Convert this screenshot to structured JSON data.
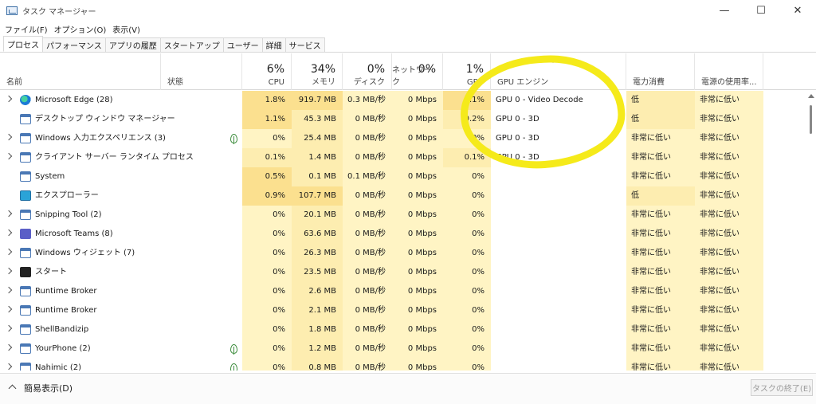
{
  "window": {
    "title": "タスク マネージャー",
    "minimize_icon": "minimize-icon",
    "maximize_icon": "maximize-icon",
    "close_icon": "close-icon"
  },
  "menu": [
    "ファイル(F)",
    "オプション(O)",
    "表示(V)"
  ],
  "tabs": [
    "プロセス",
    "パフォーマンス",
    "アプリの履歴",
    "スタートアップ",
    "ユーザー",
    "詳細",
    "サービス"
  ],
  "active_tab": "プロセス",
  "columns": {
    "name": "名前",
    "status": "状態",
    "cpu": {
      "pct": "6%",
      "label": "CPU"
    },
    "memory": {
      "pct": "34%",
      "label": "メモリ"
    },
    "disk": {
      "pct": "0%",
      "label": "ディスク"
    },
    "network": {
      "pct": "0%",
      "label": "ネットワーク"
    },
    "gpu": {
      "pct": "1%",
      "label": "GPU"
    },
    "gpu_engine": "GPU エンジン",
    "power": "電力消費",
    "power_trend": "電源の使用率..."
  },
  "colors": {
    "heat_light": "#fff4c4",
    "heat_medium": "#fdedb0",
    "heat_strong": "#fbe08f",
    "annotation": "#f5ea1a"
  },
  "processes": [
    {
      "name": "Microsoft Edge (28)",
      "icon": "edge-icon",
      "expandable": true,
      "leaf": false,
      "cpu": "1.8%",
      "memory": "919.7 MB",
      "disk": "0.3 MB/秒",
      "network": "0 Mbps",
      "gpu": "1.1%",
      "gpu_engine": "GPU 0 - Video Decode",
      "power": "低",
      "power_trend": "非常に低い"
    },
    {
      "name": "デスクトップ ウィンドウ マネージャー",
      "icon": "window-icon",
      "expandable": false,
      "leaf": false,
      "cpu": "1.1%",
      "memory": "45.3 MB",
      "disk": "0 MB/秒",
      "network": "0 Mbps",
      "gpu": "0.2%",
      "gpu_engine": "GPU 0 - 3D",
      "power": "低",
      "power_trend": "非常に低い"
    },
    {
      "name": "Windows 入力エクスペリエンス (3)",
      "icon": "window-icon",
      "expandable": true,
      "leaf": true,
      "cpu": "0%",
      "memory": "25.4 MB",
      "disk": "0 MB/秒",
      "network": "0 Mbps",
      "gpu": "0%",
      "gpu_engine": "GPU 0 - 3D",
      "power": "非常に低い",
      "power_trend": "非常に低い"
    },
    {
      "name": "クライアント サーバー ランタイム プロセス",
      "icon": "window-icon",
      "expandable": true,
      "leaf": false,
      "cpu": "0.1%",
      "memory": "1.4 MB",
      "disk": "0 MB/秒",
      "network": "0 Mbps",
      "gpu": "0.1%",
      "gpu_engine": "GPU 0 - 3D",
      "power": "非常に低い",
      "power_trend": "非常に低い"
    },
    {
      "name": "System",
      "icon": "window-icon",
      "expandable": false,
      "leaf": false,
      "cpu": "0.5%",
      "memory": "0.1 MB",
      "disk": "0.1 MB/秒",
      "network": "0 Mbps",
      "gpu": "0%",
      "gpu_engine": "",
      "power": "非常に低い",
      "power_trend": "非常に低い"
    },
    {
      "name": "エクスプローラー",
      "icon": "monitor-icon",
      "expandable": false,
      "leaf": false,
      "cpu": "0.9%",
      "memory": "107.7 MB",
      "disk": "0 MB/秒",
      "network": "0 Mbps",
      "gpu": "0%",
      "gpu_engine": "",
      "power": "低",
      "power_trend": "非常に低い"
    },
    {
      "name": "Snipping Tool (2)",
      "icon": "snipping-icon",
      "expandable": true,
      "leaf": false,
      "cpu": "0%",
      "memory": "20.1 MB",
      "disk": "0 MB/秒",
      "network": "0 Mbps",
      "gpu": "0%",
      "gpu_engine": "",
      "power": "非常に低い",
      "power_trend": "非常に低い"
    },
    {
      "name": "Microsoft Teams (8)",
      "icon": "teams-icon",
      "expandable": true,
      "leaf": false,
      "cpu": "0%",
      "memory": "63.6 MB",
      "disk": "0 MB/秒",
      "network": "0 Mbps",
      "gpu": "0%",
      "gpu_engine": "",
      "power": "非常に低い",
      "power_trend": "非常に低い"
    },
    {
      "name": "Windows ウィジェット (7)",
      "icon": "widgets-icon",
      "expandable": true,
      "leaf": false,
      "cpu": "0%",
      "memory": "26.3 MB",
      "disk": "0 MB/秒",
      "network": "0 Mbps",
      "gpu": "0%",
      "gpu_engine": "",
      "power": "非常に低い",
      "power_trend": "非常に低い"
    },
    {
      "name": "スタート",
      "icon": "start-icon",
      "expandable": true,
      "leaf": false,
      "cpu": "0%",
      "memory": "23.5 MB",
      "disk": "0 MB/秒",
      "network": "0 Mbps",
      "gpu": "0%",
      "gpu_engine": "",
      "power": "非常に低い",
      "power_trend": "非常に低い"
    },
    {
      "name": "Runtime Broker",
      "icon": "window-icon",
      "expandable": true,
      "leaf": false,
      "cpu": "0%",
      "memory": "2.6 MB",
      "disk": "0 MB/秒",
      "network": "0 Mbps",
      "gpu": "0%",
      "gpu_engine": "",
      "power": "非常に低い",
      "power_trend": "非常に低い"
    },
    {
      "name": "Runtime Broker",
      "icon": "window-icon",
      "expandable": true,
      "leaf": false,
      "cpu": "0%",
      "memory": "2.1 MB",
      "disk": "0 MB/秒",
      "network": "0 Mbps",
      "gpu": "0%",
      "gpu_engine": "",
      "power": "非常に低い",
      "power_trend": "非常に低い"
    },
    {
      "name": "ShellBandizip",
      "icon": "window-icon",
      "expandable": true,
      "leaf": false,
      "cpu": "0%",
      "memory": "1.8 MB",
      "disk": "0 MB/秒",
      "network": "0 Mbps",
      "gpu": "0%",
      "gpu_engine": "",
      "power": "非常に低い",
      "power_trend": "非常に低い"
    },
    {
      "name": "YourPhone (2)",
      "icon": "window-icon",
      "expandable": true,
      "leaf": true,
      "cpu": "0%",
      "memory": "1.2 MB",
      "disk": "0 MB/秒",
      "network": "0 Mbps",
      "gpu": "0%",
      "gpu_engine": "",
      "power": "非常に低い",
      "power_trend": "非常に低い"
    },
    {
      "name": "Nahimic (2)",
      "icon": "window-icon",
      "expandable": true,
      "leaf": true,
      "cpu": "0%",
      "memory": "0.8 MB",
      "disk": "0 MB/秒",
      "network": "0 Mbps",
      "gpu": "0%",
      "gpu_engine": "",
      "power": "非常に低い",
      "power_trend": "非常に低い"
    }
  ],
  "footer": {
    "fewer_details": "簡易表示(D)",
    "end_task": "タスクの終了(E)"
  }
}
